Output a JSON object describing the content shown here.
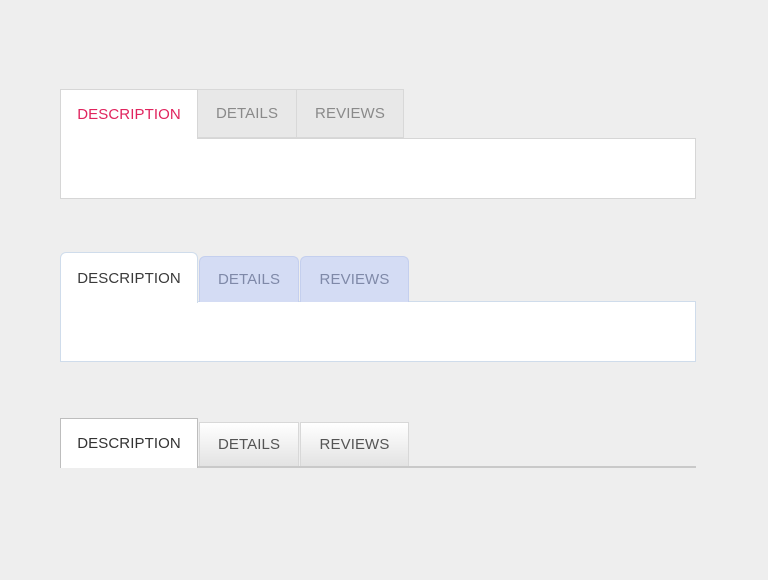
{
  "colors": {
    "background": "#eeeeee",
    "accent_active_text": "#e0245e",
    "inactive_text": "#8a8a8a",
    "blue_tab_bg": "#d4dcf4",
    "blue_tab_text": "#7f89a8"
  },
  "tabsets": [
    {
      "tabs": [
        {
          "label": "DESCRIPTION",
          "active": true
        },
        {
          "label": "DETAILS",
          "active": false
        },
        {
          "label": "REVIEWS",
          "active": false
        }
      ]
    },
    {
      "tabs": [
        {
          "label": "DESCRIPTION",
          "active": true
        },
        {
          "label": "DETAILS",
          "active": false
        },
        {
          "label": "REVIEWS",
          "active": false
        }
      ]
    },
    {
      "tabs": [
        {
          "label": "DESCRIPTION",
          "active": true
        },
        {
          "label": "DETAILS",
          "active": false
        },
        {
          "label": "REVIEWS",
          "active": false
        }
      ]
    }
  ]
}
